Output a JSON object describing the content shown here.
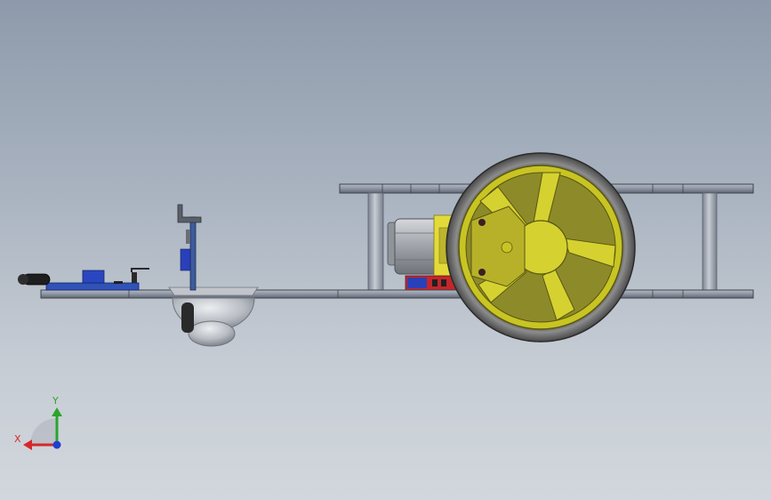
{
  "title": "",
  "triad": {
    "x_label": "X",
    "y_label": "Y",
    "x_color": "#d62828",
    "y_color": "#2aa52a",
    "z_color": "#1f3fd0"
  },
  "colors": {
    "background_top": "#8e9aab",
    "background_bottom": "#d2d7dd",
    "plate": "#9aa1ad",
    "plate_edge": "#4b4f58",
    "wheel_hub": "#c8c424",
    "tire": "#6a6a6a",
    "standoff": "#a3a9b4",
    "motor": "#b5b8bd",
    "motor_cap": "#e3da3a",
    "pcb": "#3a5fb0",
    "pcb_red": "#c4262a",
    "caster": "#b9bcc2"
  },
  "parts": [
    "lower-chassis-plate",
    "upper-chassis-plate",
    "standoff-rear",
    "standoff-front",
    "drive-wheel",
    "gear-motor",
    "motor-driver-board",
    "caster-ball",
    "sensor-mount-bracket",
    "front-sensor-board",
    "ir-emitter"
  ]
}
